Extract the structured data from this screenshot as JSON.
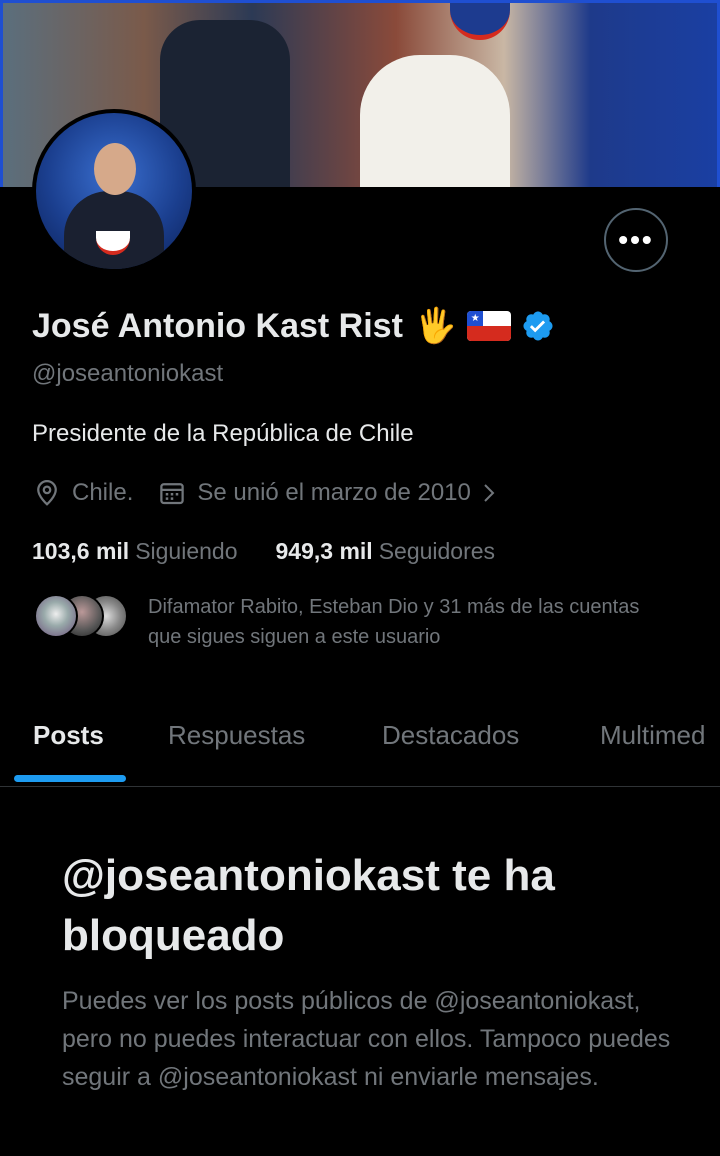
{
  "profile": {
    "name": "José Antonio Kast Rist",
    "name_emoji": "🖐",
    "handle": "@joseantoniokast",
    "bio": "Presidente de la República de Chile",
    "location": "Chile.",
    "joined": "Se unió el marzo de 2010",
    "following_count": "103,6 mil",
    "following_label": "Siguiendo",
    "followers_count": "949,3 mil",
    "followers_label": "Seguidores",
    "followed_by": "Difamator Rabito, Esteban Dio y 31 más de las cuentas que sigues siguen a este usuario",
    "more_button": "•••"
  },
  "tabs": [
    "Posts",
    "Respuestas",
    "Destacados",
    "Multimed"
  ],
  "blocked": {
    "title": "@joseantoniokast te ha bloqueado",
    "description": "Puedes ver los posts públicos de @joseantoniokast, pero no puedes interactuar con ellos. Tampoco puedes seguir a @joseantoniokast ni enviarle mensajes."
  },
  "colors": {
    "background": "#000000",
    "primary_text": "#e7e9ea",
    "secondary_text": "#71767b",
    "accent": "#1d9bf0",
    "chile_red": "#d52b1e",
    "chile_blue": "#1f4fd1"
  },
  "icons": {
    "location": "location-pin-icon",
    "calendar": "calendar-icon",
    "verified": "verified-badge-icon",
    "more": "more-options-icon"
  }
}
